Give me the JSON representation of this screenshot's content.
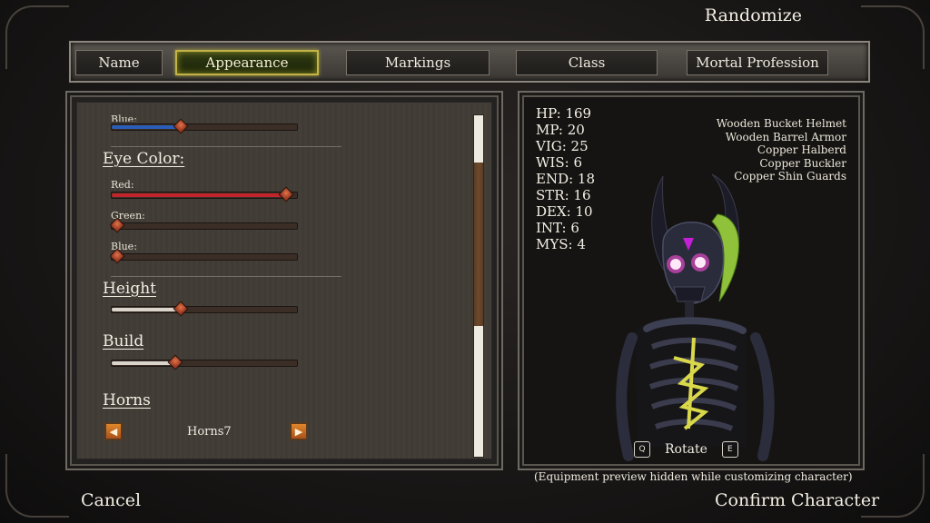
{
  "header": {
    "randomize_label": "Randomize"
  },
  "tabs": [
    {
      "label": "Name",
      "active": false
    },
    {
      "label": "Appearance",
      "active": true
    },
    {
      "label": "Markings",
      "active": false
    },
    {
      "label": "Class",
      "active": false
    },
    {
      "label": "Mortal Profession",
      "active": false
    }
  ],
  "customize": {
    "partial_blue_label": "Blue:",
    "eye_color": {
      "title": "Eye Color:",
      "red_label": "Red:",
      "green_label": "Green:",
      "blue_label": "Blue:",
      "red_value": 0.96,
      "green_value": 0.0,
      "blue_value": 0.0
    },
    "height": {
      "title": "Height",
      "value": 0.36
    },
    "build": {
      "title": "Build",
      "value": 0.33
    },
    "horns": {
      "title": "Horns",
      "value": "Horns7"
    },
    "top_blue_value": 0.36
  },
  "stats": [
    "HP: 169",
    "MP: 20",
    "VIG: 25",
    "WIS: 6",
    "END: 18",
    "STR: 16",
    "DEX: 10",
    "INT: 6",
    "MYS: 4"
  ],
  "equipment": [
    "Wooden Bucket Helmet",
    "Wooden Barrel Armor",
    "Copper Halberd",
    "Copper Buckler",
    "Copper Shin Guards"
  ],
  "preview": {
    "rotate_label": "Rotate",
    "rotate_left_key": "Q",
    "rotate_right_key": "E",
    "note": "(Equipment preview hidden while customizing character)"
  },
  "footer": {
    "cancel_label": "Cancel",
    "confirm_label": "Confirm Character"
  },
  "colors": {
    "active_tab_border": "#c4b24a",
    "red_fill": "#c0242c",
    "blue_fill": "#2a5db8",
    "white_fill": "#d9d4cc",
    "eye_glow": "#ff4fd8",
    "hair": "#8fc23a",
    "ribs": "#d9d84a"
  }
}
